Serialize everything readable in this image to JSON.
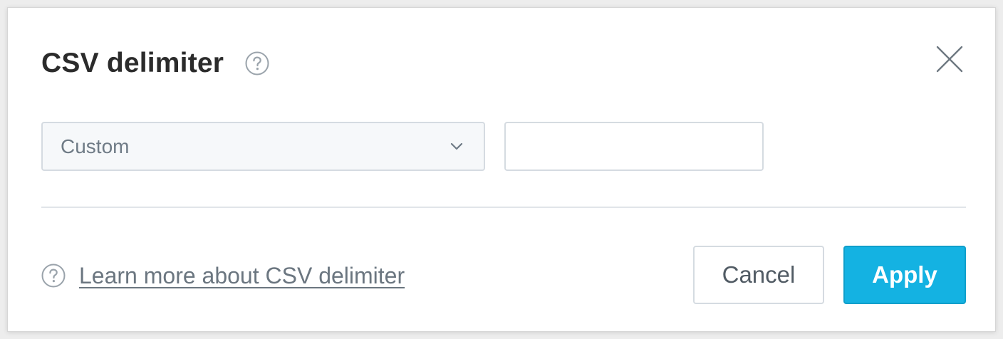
{
  "dialog": {
    "title": "CSV delimiter",
    "help_icon": "question-circle-icon",
    "close_icon": "close-icon"
  },
  "delimiter": {
    "select_value": "Custom",
    "select_icon": "chevron-down-icon",
    "custom_value": "",
    "custom_placeholder": ""
  },
  "footer": {
    "learn_more_icon": "question-circle-icon",
    "learn_more_label": "Learn more about CSV delimiter",
    "cancel_label": "Cancel",
    "apply_label": "Apply"
  },
  "colors": {
    "accent": "#14b2e2",
    "title_text": "#2b2b2b",
    "muted_text": "#6b7680",
    "border": "#d5dbe1"
  }
}
